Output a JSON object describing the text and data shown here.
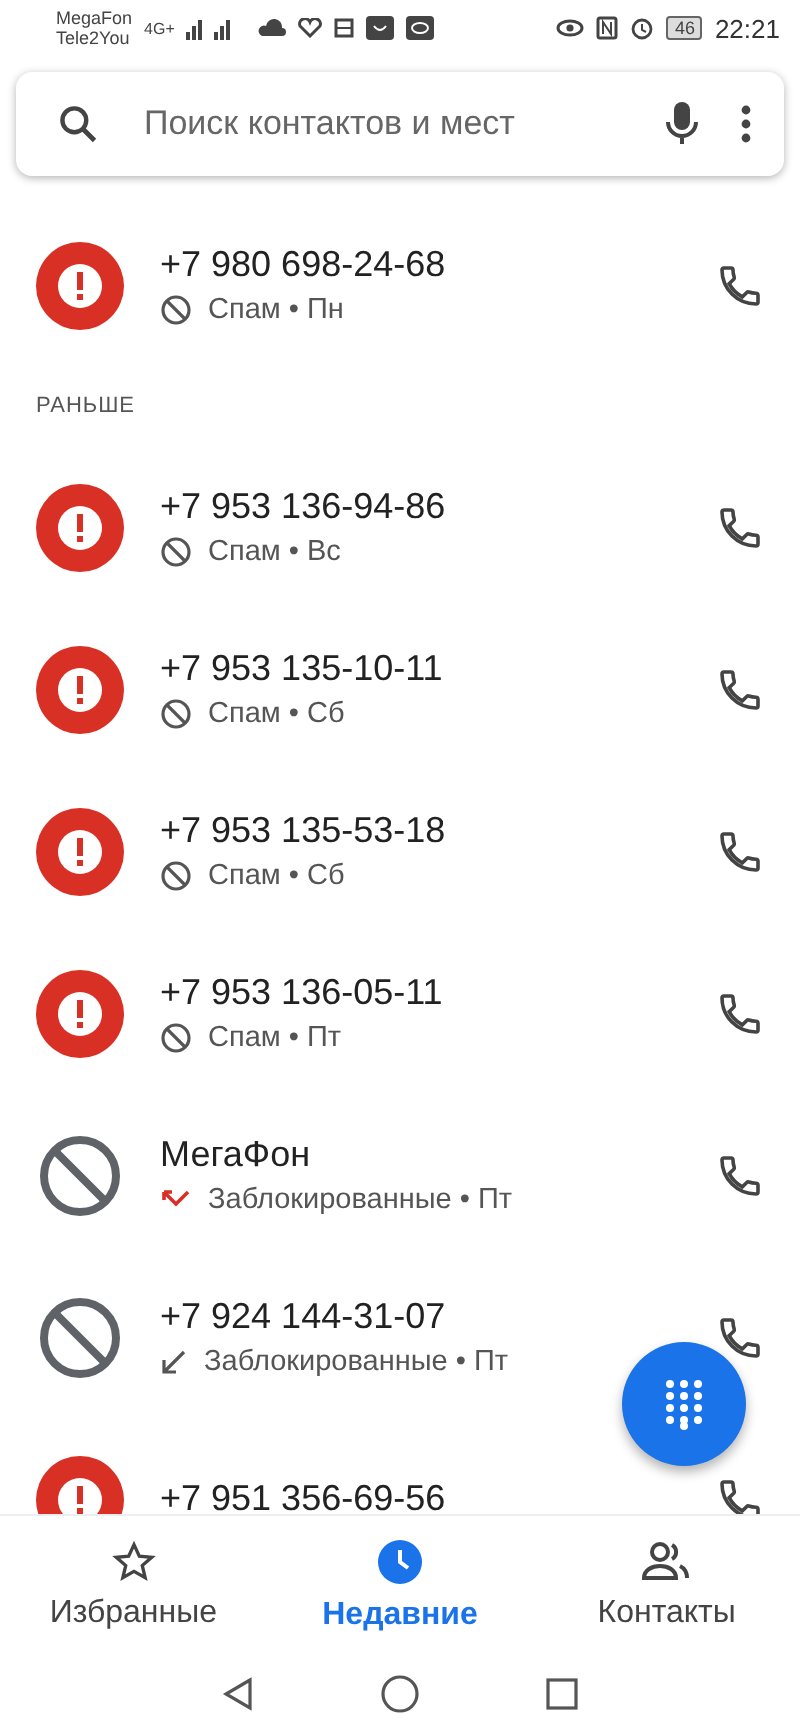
{
  "status_bar": {
    "carrier_1": "MegaFon",
    "carrier_2": "Tele2You",
    "network": "4G+",
    "battery": "46",
    "time": "22:21"
  },
  "search": {
    "placeholder": "Поиск контактов и мест"
  },
  "sections": [
    {
      "rows": [
        {
          "kind": "spam",
          "title": "+7 980 698-24-68",
          "details": {
            "kind": "blocked",
            "text": "Спам • Пн"
          }
        }
      ]
    },
    {
      "header": "РАНЬШЕ",
      "rows": [
        {
          "kind": "spam",
          "title": "+7 953 136-94-86",
          "details": {
            "kind": "blocked",
            "text": "Спам • Вс"
          }
        },
        {
          "kind": "spam",
          "title": "+7 953 135-10-11",
          "details": {
            "kind": "blocked",
            "text": "Спам • Сб"
          }
        },
        {
          "kind": "spam",
          "title": "+7 953 135-53-18",
          "details": {
            "kind": "blocked",
            "text": "Спам • Сб"
          }
        },
        {
          "kind": "spam",
          "title": "+7 953 136-05-11",
          "details": {
            "kind": "blocked",
            "text": "Спам • Пт"
          }
        },
        {
          "kind": "blocked",
          "title": "МегаФон",
          "details": {
            "kind": "missed",
            "text": "Заблокированные • Пт"
          }
        },
        {
          "kind": "blocked",
          "title": "+7 924 144-31-07",
          "details": {
            "kind": "incoming",
            "text": "Заблокированные • Пт"
          }
        },
        {
          "kind": "spam",
          "title": "+7 951 356-69-56"
        }
      ]
    }
  ],
  "bottom_nav": [
    {
      "label": "Избранные",
      "selected": false
    },
    {
      "label": "Недавние",
      "selected": true
    },
    {
      "label": "Контакты",
      "selected": false
    }
  ]
}
